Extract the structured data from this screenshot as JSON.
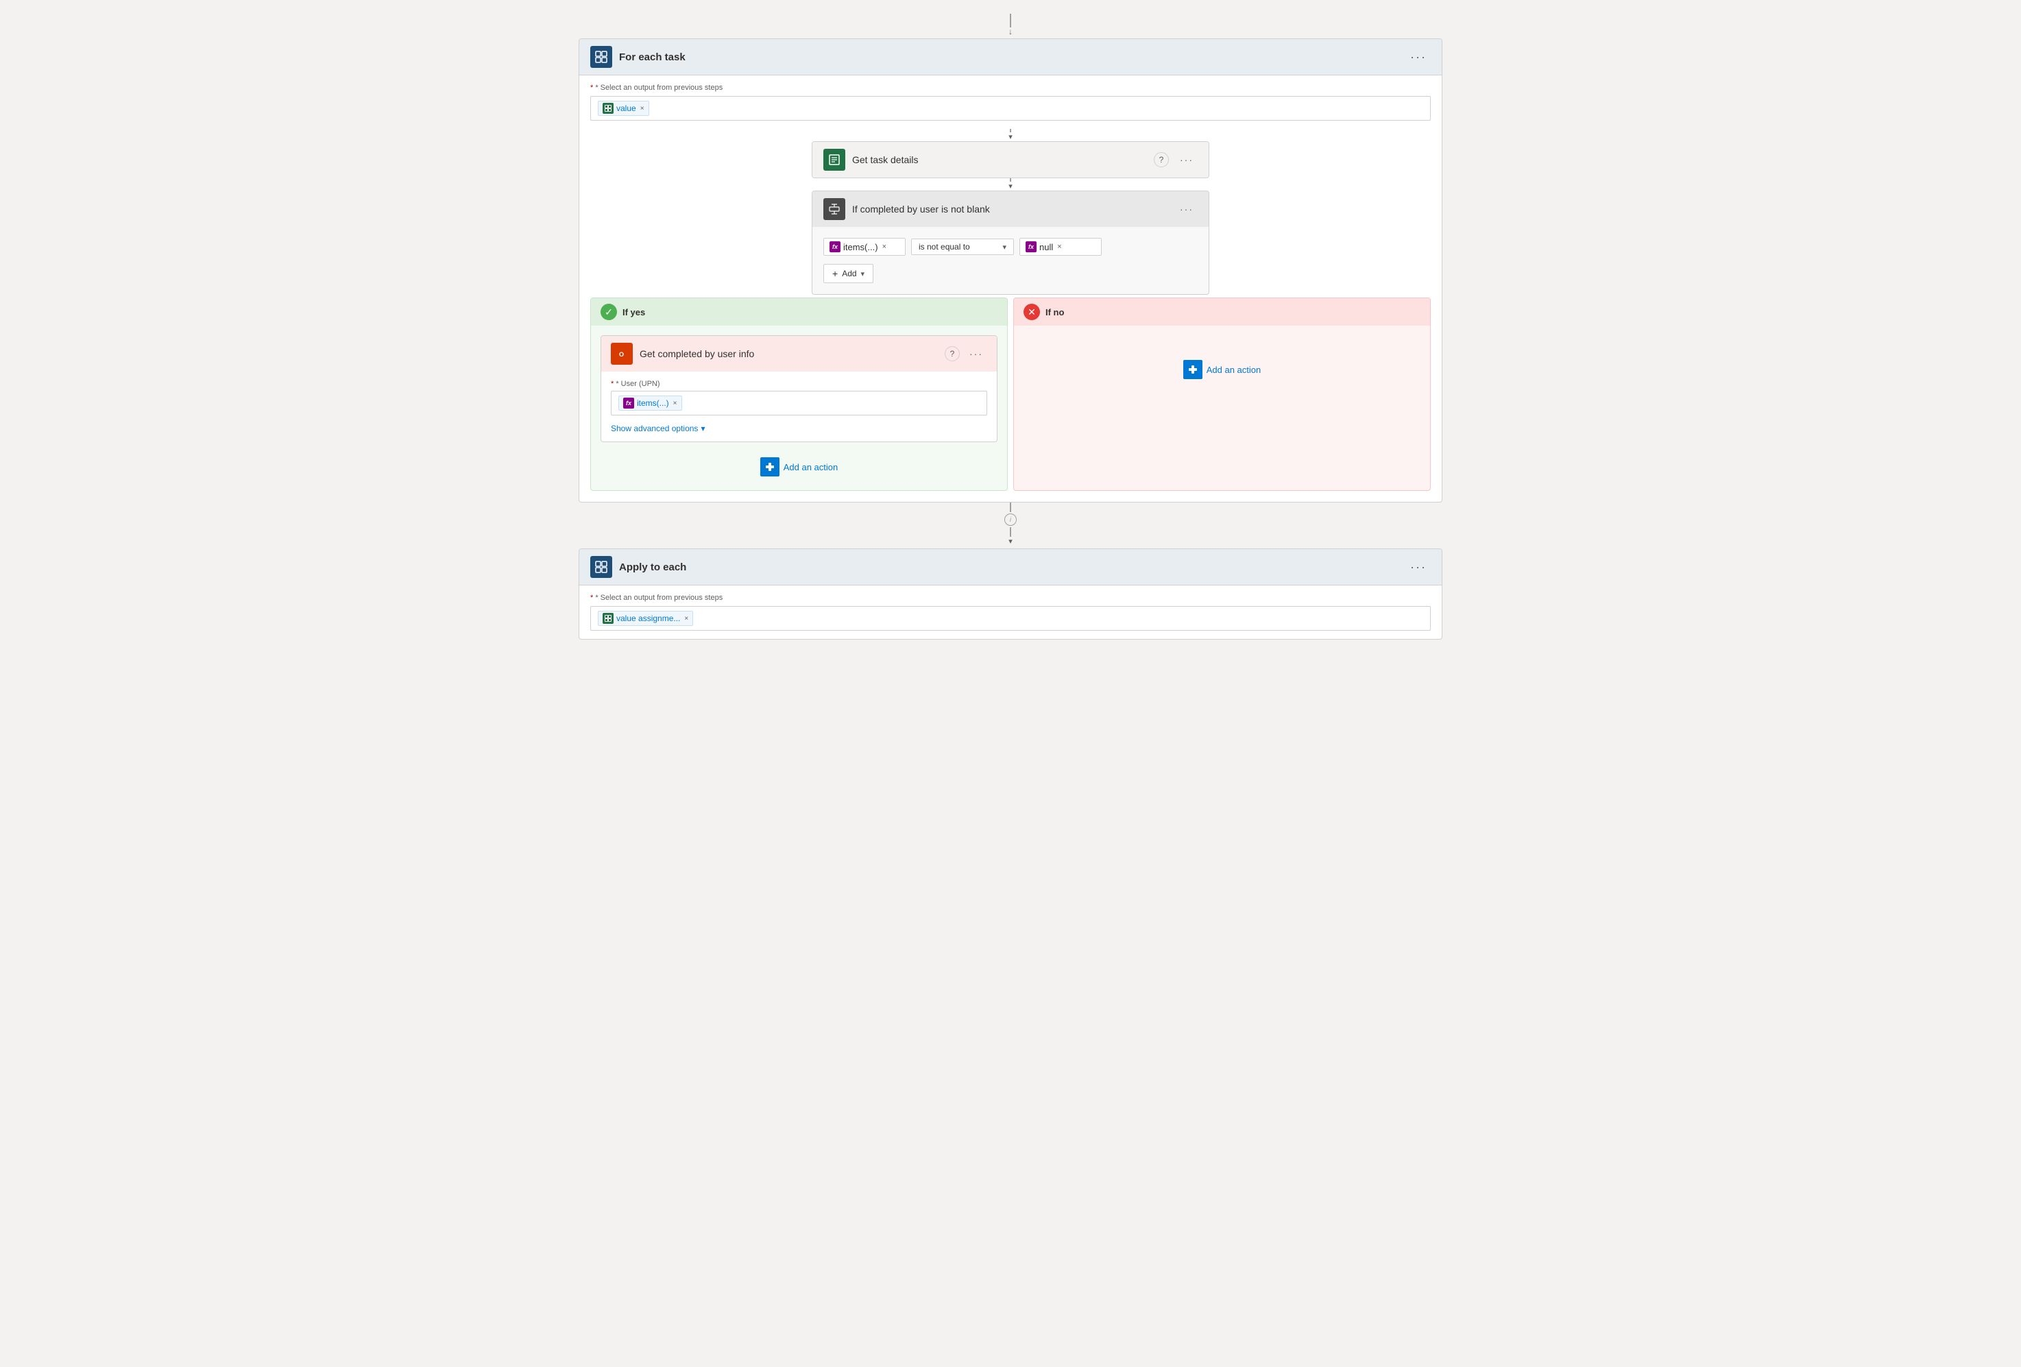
{
  "top_arrow": {
    "visible": true
  },
  "for_each": {
    "title": "For each task",
    "field_label": "* Select an output from previous steps",
    "token_label": "value",
    "required": true
  },
  "get_task": {
    "title": "Get task details",
    "icon_label": "📋"
  },
  "condition": {
    "title": "If completed by user is not blank",
    "left_token": "items(...)",
    "operator": "is not equal to",
    "right_token": "null",
    "add_label": "Add"
  },
  "split": {
    "yes_label": "If yes",
    "no_label": "If no"
  },
  "office_action": {
    "title": "Get completed by user info",
    "user_label": "* User (UPN)",
    "user_token": "items(...)",
    "show_advanced": "Show advanced options"
  },
  "add_action_yes": {
    "label": "Add an action"
  },
  "add_action_no": {
    "label": "Add an action"
  },
  "apply_to_each": {
    "title": "Apply to each",
    "field_label": "* Select an output from previous steps",
    "token_label": "value assignme...",
    "required": true
  },
  "icons": {
    "loop": "⟲",
    "table": "⊞",
    "filter": "⊟",
    "office": "O",
    "check": "✓",
    "cross": "✕",
    "info": "i",
    "chevron_down": "▾",
    "plus": "+",
    "dots": "···",
    "question": "?",
    "arrow_down": "↓"
  }
}
